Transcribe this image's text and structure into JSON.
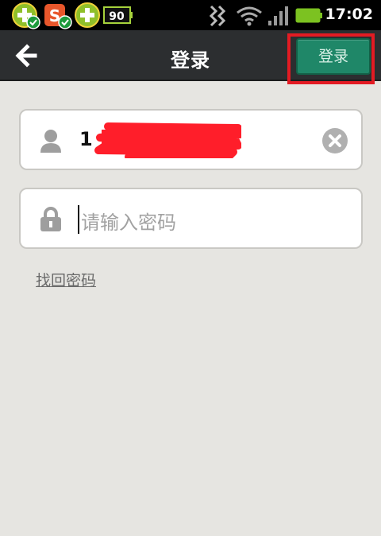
{
  "status_bar": {
    "time": "17:02",
    "battery_badge": "90",
    "app_badge": "S",
    "icons": [
      "shield-plus-check-icon",
      "sogou-input-icon",
      "shield-plus-icon",
      "battery-badge-icon",
      "data-activity-icon",
      "wifi-icon",
      "signal-icon",
      "battery-icon"
    ]
  },
  "title_bar": {
    "title": "登录",
    "login_button": "登录"
  },
  "form": {
    "username_prefix": "1",
    "password_placeholder": "请输入密码",
    "find_password": "找回密码"
  },
  "colors": {
    "accent_green": "#1f8768",
    "highlight_red": "#e31b23",
    "background": "#e6e5e1",
    "title_bar": "#2c2e30"
  }
}
